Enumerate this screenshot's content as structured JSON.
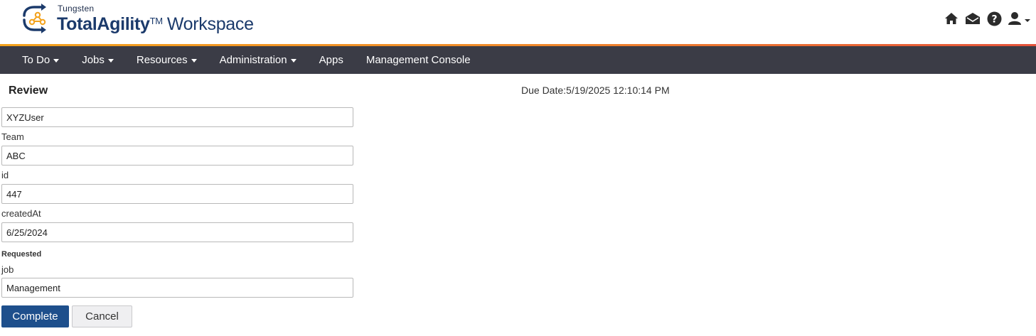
{
  "header": {
    "brand_small": "Tungsten",
    "brand_main_bold": "TotalAgility",
    "brand_tm": "TM",
    "brand_main_rest": "Workspace",
    "icons": [
      "home-icon",
      "mail-icon",
      "help-icon",
      "user-icon"
    ]
  },
  "colors": {
    "nav_bg": "#3b3c46",
    "accent_start": "#f3a21c",
    "accent_end": "#e5533a",
    "primary_button": "#1e4f8c",
    "brand_text": "#1b3a6b"
  },
  "nav": {
    "items": [
      {
        "label": "To Do",
        "dropdown": true
      },
      {
        "label": "Jobs",
        "dropdown": true
      },
      {
        "label": "Resources",
        "dropdown": true
      },
      {
        "label": "Administration",
        "dropdown": true
      },
      {
        "label": "Apps",
        "dropdown": false
      },
      {
        "label": "Management Console",
        "dropdown": false
      }
    ]
  },
  "form": {
    "title": "Review",
    "due_date_label": "Due Date:",
    "due_date_value": "5/19/2025 12:10:14 PM",
    "user_value": "XYZUser",
    "team_label": "Team",
    "team_value": "ABC",
    "id_label": "id",
    "id_value": "447",
    "created_label": "createdAt",
    "created_value": "6/25/2024",
    "section_label": "Requested",
    "job_label": "job",
    "job_value": "Management",
    "complete_label": "Complete",
    "cancel_label": "Cancel"
  }
}
